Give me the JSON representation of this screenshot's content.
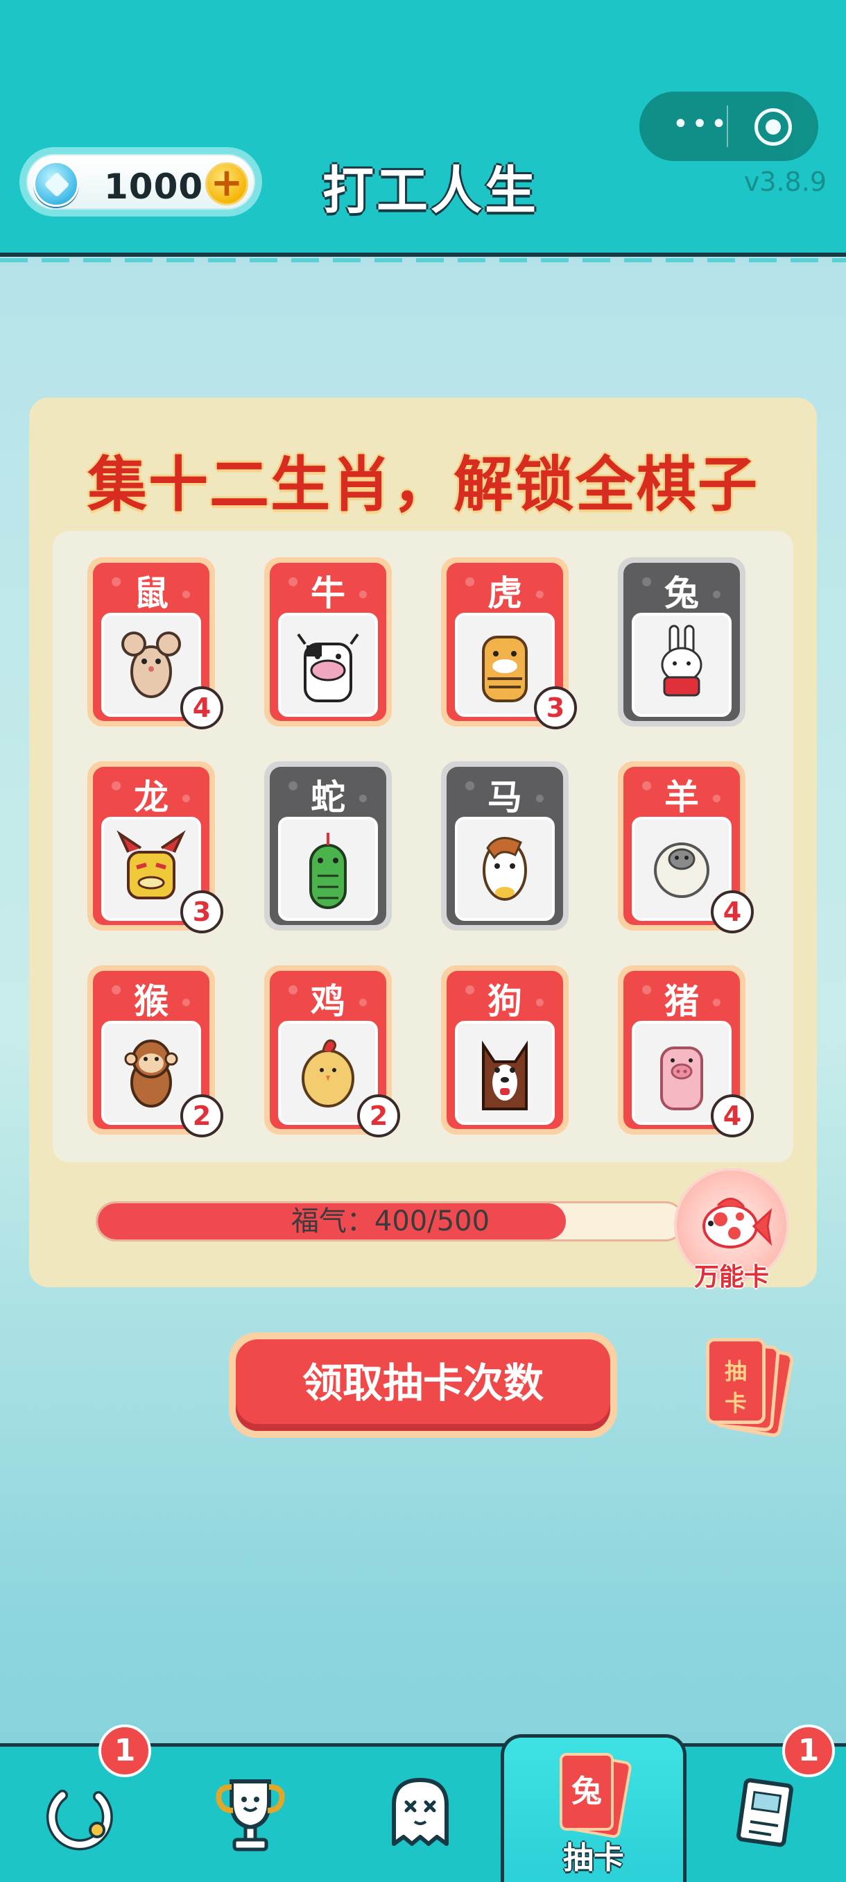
{
  "header": {
    "gem_count": "1000",
    "title": "打工人生",
    "version": "v3.8.9",
    "menu_dots": "•••"
  },
  "panel": {
    "title": "集十二生肖，解锁全棋子",
    "cards": [
      {
        "name": "鼠",
        "count": "4",
        "owned": true,
        "icon": "rat-icon"
      },
      {
        "name": "牛",
        "count": "",
        "owned": true,
        "icon": "ox-icon"
      },
      {
        "name": "虎",
        "count": "3",
        "owned": true,
        "icon": "tiger-icon"
      },
      {
        "name": "兔",
        "count": "",
        "owned": false,
        "icon": "rabbit-icon"
      },
      {
        "name": "龙",
        "count": "3",
        "owned": true,
        "icon": "dragon-icon"
      },
      {
        "name": "蛇",
        "count": "",
        "owned": false,
        "icon": "snake-icon"
      },
      {
        "name": "马",
        "count": "",
        "owned": false,
        "icon": "horse-icon"
      },
      {
        "name": "羊",
        "count": "4",
        "owned": true,
        "icon": "sheep-icon"
      },
      {
        "name": "猴",
        "count": "2",
        "owned": true,
        "icon": "monkey-icon"
      },
      {
        "name": "鸡",
        "count": "2",
        "owned": true,
        "icon": "rooster-icon"
      },
      {
        "name": "狗",
        "count": "",
        "owned": true,
        "icon": "dog-icon"
      },
      {
        "name": "猪",
        "count": "4",
        "owned": true,
        "icon": "pig-icon"
      }
    ],
    "progress": {
      "label": "福气：400/500",
      "current": 400,
      "max": 500,
      "fill_fraction": 0.8
    },
    "wild_card_label": "万能卡"
  },
  "claim_button": "领取抽卡次数",
  "card_stack": {
    "line1": "抽",
    "line2": "卡"
  },
  "nav": {
    "items": [
      {
        "icon": "spin-icon",
        "badge": "1"
      },
      {
        "icon": "trophy-icon"
      },
      {
        "icon": "ghost-icon"
      },
      {
        "icon": "rabbit-card-icon",
        "label": "抽卡",
        "card_char": "兔",
        "active": true
      },
      {
        "icon": "notebook-icon",
        "badge": "1"
      }
    ]
  },
  "colors": {
    "accent_red": "#f0494a",
    "header_teal": "#1ec5c6",
    "panel_cream": "#f1e7bf",
    "locked_gray": "#5d5d5f"
  }
}
